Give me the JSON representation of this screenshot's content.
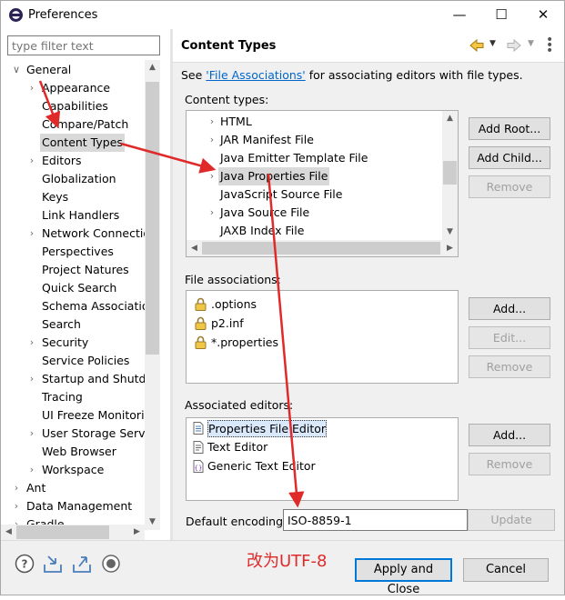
{
  "window": {
    "title": "Preferences"
  },
  "filter": {
    "placeholder": "type filter text"
  },
  "tree": [
    {
      "label": "General",
      "chevron": "v"
    },
    {
      "label": "Appearance",
      "chevron": ">"
    },
    {
      "label": "Capabilities",
      "chevron": ""
    },
    {
      "label": "Compare/Patch",
      "chevron": ""
    },
    {
      "label": "Content Types",
      "chevron": "",
      "selected": true
    },
    {
      "label": "Editors",
      "chevron": ">"
    },
    {
      "label": "Globalization",
      "chevron": ""
    },
    {
      "label": "Keys",
      "chevron": ""
    },
    {
      "label": "Link Handlers",
      "chevron": ""
    },
    {
      "label": "Network Connectio",
      "chevron": ">"
    },
    {
      "label": "Perspectives",
      "chevron": ""
    },
    {
      "label": "Project Natures",
      "chevron": ""
    },
    {
      "label": "Quick Search",
      "chevron": ""
    },
    {
      "label": "Schema Associatio",
      "chevron": ""
    },
    {
      "label": "Search",
      "chevron": ""
    },
    {
      "label": "Security",
      "chevron": ">"
    },
    {
      "label": "Service Policies",
      "chevron": ""
    },
    {
      "label": "Startup and Shutdo",
      "chevron": ">"
    },
    {
      "label": "Tracing",
      "chevron": ""
    },
    {
      "label": "UI Freeze Monitorin",
      "chevron": ""
    },
    {
      "label": "User Storage Servic",
      "chevron": ">"
    },
    {
      "label": "Web Browser",
      "chevron": ""
    },
    {
      "label": "Workspace",
      "chevron": ">"
    },
    {
      "label": "Ant",
      "chevron": ">"
    },
    {
      "label": "Data Management",
      "chevron": ">"
    },
    {
      "label": "Gradle",
      "chevron": ">"
    }
  ],
  "page": {
    "title": "Content Types",
    "see_prefix": "See ",
    "see_link": "'File Associations'",
    "see_suffix": " for associating editors with file types.",
    "content_types_label": "Content types:",
    "content_types": [
      {
        "label": "HTML",
        "chevron": ">"
      },
      {
        "label": "JAR Manifest File",
        "chevron": ">"
      },
      {
        "label": "Java Emitter Template File",
        "chevron": ""
      },
      {
        "label": "Java Properties File",
        "chevron": ">",
        "selected": true
      },
      {
        "label": "JavaScript Source File",
        "chevron": ""
      },
      {
        "label": "Java Source File",
        "chevron": ">"
      },
      {
        "label": "JAXB Index File",
        "chevron": ""
      }
    ],
    "content_buttons": {
      "add_root": "Add Root...",
      "add_child": "Add Child...",
      "remove": "Remove"
    },
    "file_assoc_label": "File associations:",
    "file_assocs": [
      ".options",
      "p2.inf",
      "*.properties"
    ],
    "file_buttons": {
      "add": "Add...",
      "edit": "Edit...",
      "remove": "Remove"
    },
    "editors_label": "Associated editors:",
    "editors": [
      {
        "label": "Properties File Editor",
        "icon": "properties-file-icon"
      },
      {
        "label": "Text Editor",
        "icon": "text-file-icon"
      },
      {
        "label": "Generic Text Editor",
        "icon": "generic-text-icon"
      }
    ],
    "editor_buttons": {
      "add": "Add...",
      "remove": "Remove"
    },
    "encoding_label": "Default encoding:",
    "encoding_value": "ISO-8859-1",
    "update_label": "Update"
  },
  "annotation": {
    "text": "改为UTF-8",
    "color": "#e02a2a"
  },
  "bottom": {
    "apply_close": "Apply and Close",
    "cancel": "Cancel"
  },
  "colors": {
    "link": "#0066cc",
    "selection": "#d9d9d9",
    "primary_border": "#0078d7",
    "annotation": "#e02a2a"
  }
}
